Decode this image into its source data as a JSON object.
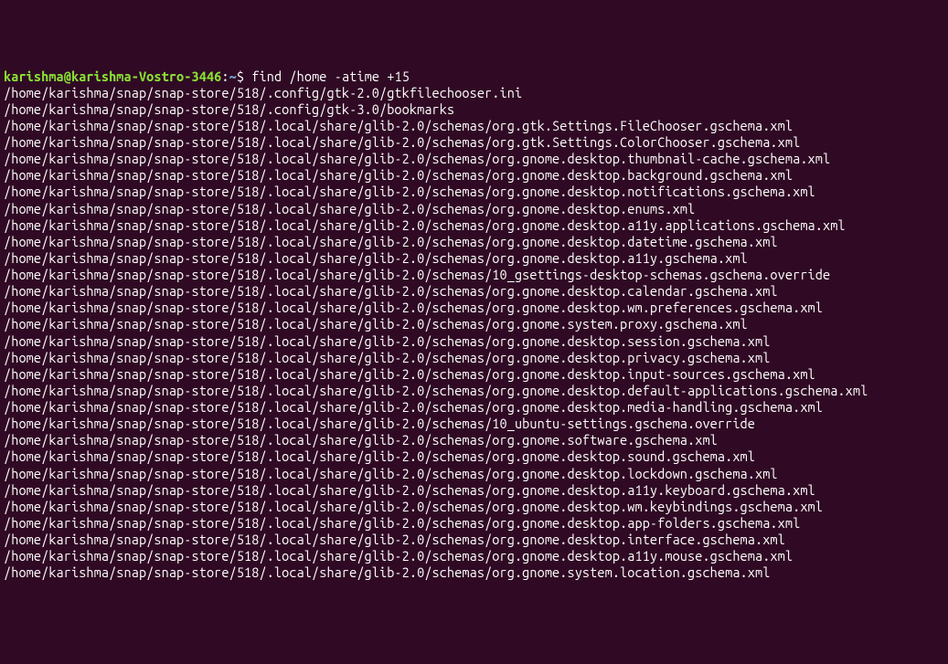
{
  "prompt": {
    "user_host": "karishma@karishma-Vostro-3446",
    "sep1": ":",
    "path": "~",
    "sep2": "$ ",
    "command": "find /home -atime +15"
  },
  "lines": [
    "/home/karishma/snap/snap-store/518/.config/gtk-2.0/gtkfilechooser.ini",
    "/home/karishma/snap/snap-store/518/.config/gtk-3.0/bookmarks",
    "/home/karishma/snap/snap-store/518/.local/share/glib-2.0/schemas/org.gtk.Settings.FileChooser.gschema.xml",
    "/home/karishma/snap/snap-store/518/.local/share/glib-2.0/schemas/org.gtk.Settings.ColorChooser.gschema.xml",
    "/home/karishma/snap/snap-store/518/.local/share/glib-2.0/schemas/org.gnome.desktop.thumbnail-cache.gschema.xml",
    "/home/karishma/snap/snap-store/518/.local/share/glib-2.0/schemas/org.gnome.desktop.background.gschema.xml",
    "/home/karishma/snap/snap-store/518/.local/share/glib-2.0/schemas/org.gnome.desktop.notifications.gschema.xml",
    "/home/karishma/snap/snap-store/518/.local/share/glib-2.0/schemas/org.gnome.desktop.enums.xml",
    "/home/karishma/snap/snap-store/518/.local/share/glib-2.0/schemas/org.gnome.desktop.a11y.applications.gschema.xml",
    "/home/karishma/snap/snap-store/518/.local/share/glib-2.0/schemas/org.gnome.desktop.datetime.gschema.xml",
    "/home/karishma/snap/snap-store/518/.local/share/glib-2.0/schemas/org.gnome.desktop.a11y.gschema.xml",
    "/home/karishma/snap/snap-store/518/.local/share/glib-2.0/schemas/10_gsettings-desktop-schemas.gschema.override",
    "/home/karishma/snap/snap-store/518/.local/share/glib-2.0/schemas/org.gnome.desktop.calendar.gschema.xml",
    "/home/karishma/snap/snap-store/518/.local/share/glib-2.0/schemas/org.gnome.desktop.wm.preferences.gschema.xml",
    "/home/karishma/snap/snap-store/518/.local/share/glib-2.0/schemas/org.gnome.system.proxy.gschema.xml",
    "/home/karishma/snap/snap-store/518/.local/share/glib-2.0/schemas/org.gnome.desktop.session.gschema.xml",
    "/home/karishma/snap/snap-store/518/.local/share/glib-2.0/schemas/org.gnome.desktop.privacy.gschema.xml",
    "/home/karishma/snap/snap-store/518/.local/share/glib-2.0/schemas/org.gnome.desktop.input-sources.gschema.xml",
    "/home/karishma/snap/snap-store/518/.local/share/glib-2.0/schemas/org.gnome.desktop.default-applications.gschema.xml",
    "/home/karishma/snap/snap-store/518/.local/share/glib-2.0/schemas/org.gnome.desktop.media-handling.gschema.xml",
    "/home/karishma/snap/snap-store/518/.local/share/glib-2.0/schemas/10_ubuntu-settings.gschema.override",
    "/home/karishma/snap/snap-store/518/.local/share/glib-2.0/schemas/org.gnome.software.gschema.xml",
    "/home/karishma/snap/snap-store/518/.local/share/glib-2.0/schemas/org.gnome.desktop.sound.gschema.xml",
    "/home/karishma/snap/snap-store/518/.local/share/glib-2.0/schemas/org.gnome.desktop.lockdown.gschema.xml",
    "/home/karishma/snap/snap-store/518/.local/share/glib-2.0/schemas/org.gnome.desktop.a11y.keyboard.gschema.xml",
    "/home/karishma/snap/snap-store/518/.local/share/glib-2.0/schemas/org.gnome.desktop.wm.keybindings.gschema.xml",
    "/home/karishma/snap/snap-store/518/.local/share/glib-2.0/schemas/org.gnome.desktop.app-folders.gschema.xml",
    "/home/karishma/snap/snap-store/518/.local/share/glib-2.0/schemas/org.gnome.desktop.interface.gschema.xml",
    "/home/karishma/snap/snap-store/518/.local/share/glib-2.0/schemas/org.gnome.desktop.a11y.mouse.gschema.xml",
    "/home/karishma/snap/snap-store/518/.local/share/glib-2.0/schemas/org.gnome.system.location.gschema.xml"
  ]
}
